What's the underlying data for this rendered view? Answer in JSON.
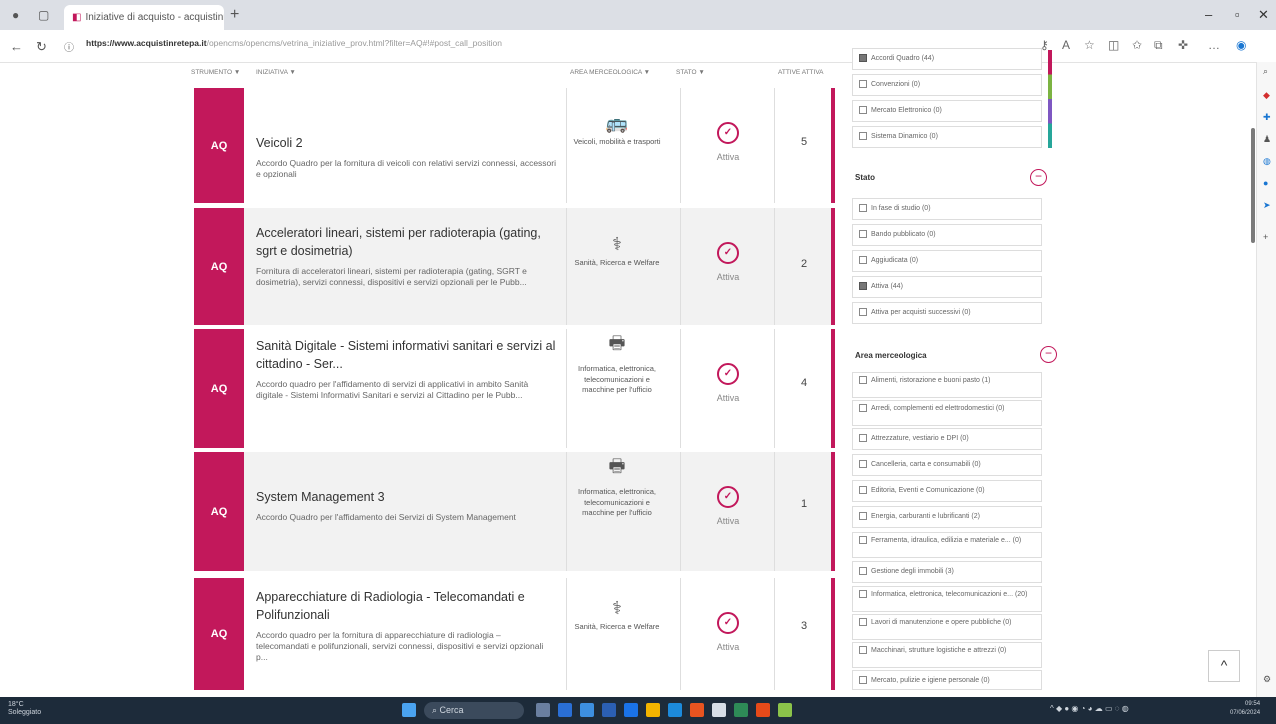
{
  "browser": {
    "tab_title": "Iniziative di acquisto - acquistinretepa",
    "tab_close": "×",
    "new_tab": "+",
    "url_domain": "https://www.acquistinretepa.it",
    "url_rest": "/opencms/opencms/vetrina_iniziative_prov.html?filter=AQ#!#post_call_position"
  },
  "table": {
    "headers": {
      "strumento": "STRUMENTO ▼",
      "iniziativa": "INIZIATIVA ▼",
      "area": "AREA MERCEOLOGICA ▼",
      "stato": "STATO ▼",
      "attive": "ATTIVE ATTIVA"
    }
  },
  "cards": [
    {
      "badge": "AQ",
      "title": "Veicoli 2",
      "desc": "Accordo Quadro per la fornitura di veicoli con relativi servizi connessi, accessori e opzionali",
      "area_icon": "bus-icon",
      "area": "Veicoli, mobilità e trasporti",
      "status": "Attiva",
      "count": "5"
    },
    {
      "badge": "AQ",
      "title": "Acceleratori lineari, sistemi per radioterapia (gating, sgrt e dosimetria)",
      "desc": "Fornitura di acceleratori lineari, sistemi per radioterapia (gating, SGRT e dosimetria), servizi connessi, dispositivi e servizi opzionali per le Pubb...",
      "area_icon": "health-icon",
      "area": "Sanità, Ricerca e Welfare",
      "status": "Attiva",
      "count": "2"
    },
    {
      "badge": "AQ",
      "title": "Sanità Digitale - Sistemi informativi sanitari e servizi al cittadino - Ser...",
      "desc": "Accordo quadro per l'affidamento di servizi di applicativi in ambito Sanità digitale - Sistemi Informativi Sanitari e servizi al Cittadino per le Pubb...",
      "area_icon": "printer-icon",
      "area": "Informatica, elettronica, telecomunicazioni e macchine per l'ufficio",
      "status": "Attiva",
      "count": "4"
    },
    {
      "badge": "AQ",
      "title": "System Management 3",
      "desc": "Accordo Quadro per l'affidamento dei Servizi di System Management",
      "area_icon": "printer-icon",
      "area": "Informatica, elettronica, telecomunicazioni e macchine per l'ufficio",
      "status": "Attiva",
      "count": "1"
    },
    {
      "badge": "AQ",
      "title": "Apparecchiature di Radiologia - Telecomandati e Polifunzionali",
      "desc": "Accordo quadro per la fornitura di apparecchiature di radiologia – telecomandati e polifunzionali, servizi connessi, dispositivi e servizi opzionali p...",
      "area_icon": "health-icon",
      "area": "Sanità, Ricerca e Welfare",
      "status": "Attiva",
      "count": "3"
    }
  ],
  "filters": {
    "strumento": [
      {
        "label": "Accordi Quadro (44)",
        "checked": true
      },
      {
        "label": "Convenzioni (0)",
        "checked": false
      },
      {
        "label": "Mercato Elettronico (0)",
        "checked": false
      },
      {
        "label": "Sistema Dinamico (0)",
        "checked": false
      }
    ],
    "stato_title": "Stato",
    "stato": [
      {
        "label": "In fase di studio (0)",
        "checked": false
      },
      {
        "label": "Bando pubblicato (0)",
        "checked": false
      },
      {
        "label": "Aggiudicata (0)",
        "checked": false
      },
      {
        "label": "Attiva (44)",
        "checked": true
      },
      {
        "label": "Attiva per acquisti successivi (0)",
        "checked": false
      }
    ],
    "area_title": "Area merceologica",
    "area": [
      {
        "label": "Alimenti, ristorazione e buoni pasto (1)",
        "checked": false
      },
      {
        "label": "Arredi, complementi ed elettrodomestici (0)",
        "checked": false
      },
      {
        "label": "Attrezzature, vestiario e DPI (0)",
        "checked": false
      },
      {
        "label": "Cancelleria, carta e consumabili (0)",
        "checked": false
      },
      {
        "label": "Editoria, Eventi e Comunicazione (0)",
        "checked": false
      },
      {
        "label": "Energia, carburanti e lubrificanti (2)",
        "checked": false
      },
      {
        "label": "Ferramenta, idraulica, edilizia e materiale e... (0)",
        "checked": false
      },
      {
        "label": "Gestione degli immobili (3)",
        "checked": false
      },
      {
        "label": "Informatica, elettronica, telecomunicazioni e... (20)",
        "checked": false
      },
      {
        "label": "Lavori di manutenzione e opere pubbliche (0)",
        "checked": false
      },
      {
        "label": "Macchinari, strutture logistiche e attrezzi (0)",
        "checked": false
      },
      {
        "label": "Mercato, pulizie e igiene personale (0)",
        "checked": false
      }
    ]
  },
  "scroll_top": "^",
  "taskbar": {
    "weather_temp": "18°C",
    "weather_desc": "Soleggiato",
    "search_placeholder": "Cerca",
    "time": "09:54",
    "date": "07/06/2024"
  }
}
